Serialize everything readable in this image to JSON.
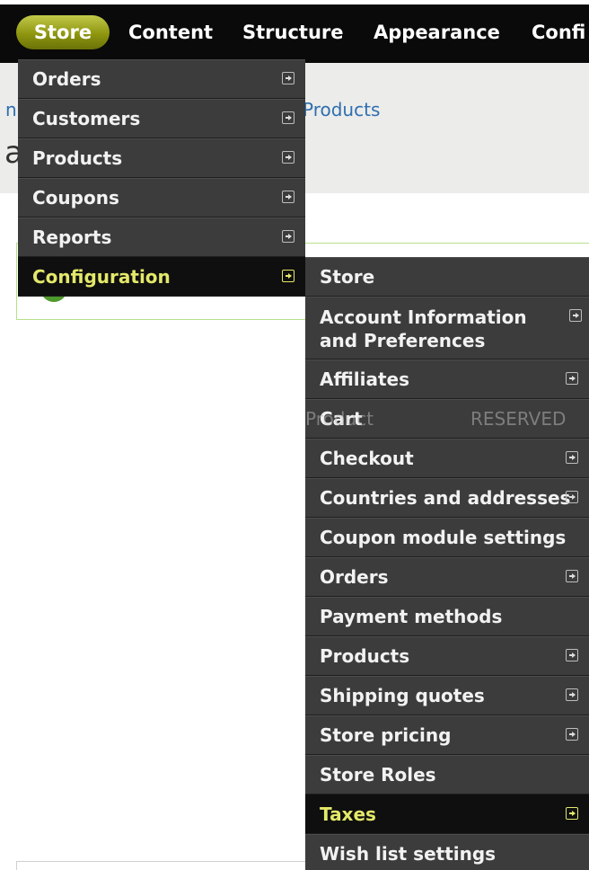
{
  "toolbar": {
    "items": [
      "Store",
      "Content",
      "Structure",
      "Appearance",
      "Confi"
    ]
  },
  "background_page": {
    "breadcrumb_fragment_1": "n",
    "breadcrumb_fragment_2": "Products",
    "title_fragment": "a",
    "column_fragment_1": "Product",
    "column_fragment_2": "RESERVED"
  },
  "store_menu": {
    "items": [
      {
        "label": "Orders"
      },
      {
        "label": "Customers"
      },
      {
        "label": "Products"
      },
      {
        "label": "Coupons"
      },
      {
        "label": "Reports"
      },
      {
        "label": "Configuration"
      }
    ]
  },
  "config_menu": {
    "items": [
      {
        "label": "Store"
      },
      {
        "label": "Account Information and Preferences"
      },
      {
        "label": "Affiliates"
      },
      {
        "label": "Cart"
      },
      {
        "label": "Checkout"
      },
      {
        "label": "Countries and addresses"
      },
      {
        "label": "Coupon module settings"
      },
      {
        "label": "Orders"
      },
      {
        "label": "Payment methods"
      },
      {
        "label": "Products"
      },
      {
        "label": "Shipping quotes"
      },
      {
        "label": "Store pricing"
      },
      {
        "label": "Store Roles"
      },
      {
        "label": "Taxes"
      },
      {
        "label": "Wish list settings"
      }
    ]
  },
  "colors": {
    "toolbar_bg": "#0a0a0a",
    "menu_bg": "#3c3c3c",
    "active_bg": "#0f0f0f",
    "active_text": "#e3e86a",
    "store_tab": "#8e960f"
  }
}
